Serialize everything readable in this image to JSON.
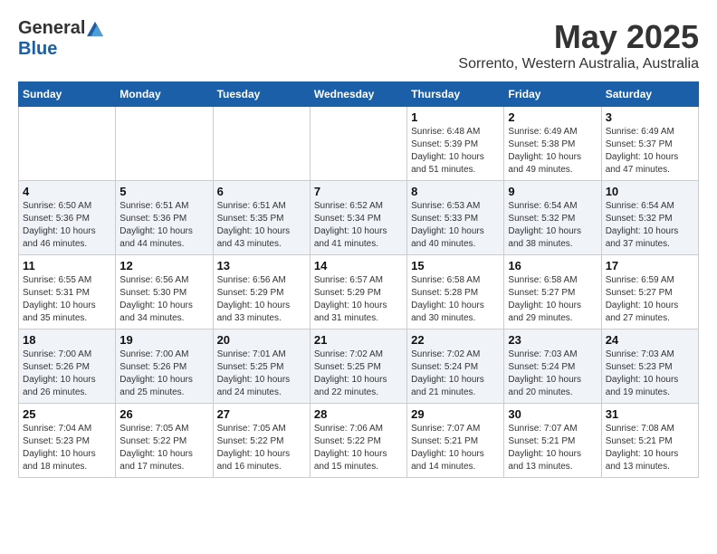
{
  "header": {
    "logo_general": "General",
    "logo_blue": "Blue",
    "month_title": "May 2025",
    "location": "Sorrento, Western Australia, Australia"
  },
  "weekdays": [
    "Sunday",
    "Monday",
    "Tuesday",
    "Wednesday",
    "Thursday",
    "Friday",
    "Saturday"
  ],
  "weeks": [
    [
      {
        "day": "",
        "sunrise": "",
        "sunset": "",
        "daylight": ""
      },
      {
        "day": "",
        "sunrise": "",
        "sunset": "",
        "daylight": ""
      },
      {
        "day": "",
        "sunrise": "",
        "sunset": "",
        "daylight": ""
      },
      {
        "day": "",
        "sunrise": "",
        "sunset": "",
        "daylight": ""
      },
      {
        "day": "1",
        "sunrise": "Sunrise: 6:48 AM",
        "sunset": "Sunset: 5:39 PM",
        "daylight": "Daylight: 10 hours and 51 minutes."
      },
      {
        "day": "2",
        "sunrise": "Sunrise: 6:49 AM",
        "sunset": "Sunset: 5:38 PM",
        "daylight": "Daylight: 10 hours and 49 minutes."
      },
      {
        "day": "3",
        "sunrise": "Sunrise: 6:49 AM",
        "sunset": "Sunset: 5:37 PM",
        "daylight": "Daylight: 10 hours and 47 minutes."
      }
    ],
    [
      {
        "day": "4",
        "sunrise": "Sunrise: 6:50 AM",
        "sunset": "Sunset: 5:36 PM",
        "daylight": "Daylight: 10 hours and 46 minutes."
      },
      {
        "day": "5",
        "sunrise": "Sunrise: 6:51 AM",
        "sunset": "Sunset: 5:36 PM",
        "daylight": "Daylight: 10 hours and 44 minutes."
      },
      {
        "day": "6",
        "sunrise": "Sunrise: 6:51 AM",
        "sunset": "Sunset: 5:35 PM",
        "daylight": "Daylight: 10 hours and 43 minutes."
      },
      {
        "day": "7",
        "sunrise": "Sunrise: 6:52 AM",
        "sunset": "Sunset: 5:34 PM",
        "daylight": "Daylight: 10 hours and 41 minutes."
      },
      {
        "day": "8",
        "sunrise": "Sunrise: 6:53 AM",
        "sunset": "Sunset: 5:33 PM",
        "daylight": "Daylight: 10 hours and 40 minutes."
      },
      {
        "day": "9",
        "sunrise": "Sunrise: 6:54 AM",
        "sunset": "Sunset: 5:32 PM",
        "daylight": "Daylight: 10 hours and 38 minutes."
      },
      {
        "day": "10",
        "sunrise": "Sunrise: 6:54 AM",
        "sunset": "Sunset: 5:32 PM",
        "daylight": "Daylight: 10 hours and 37 minutes."
      }
    ],
    [
      {
        "day": "11",
        "sunrise": "Sunrise: 6:55 AM",
        "sunset": "Sunset: 5:31 PM",
        "daylight": "Daylight: 10 hours and 35 minutes."
      },
      {
        "day": "12",
        "sunrise": "Sunrise: 6:56 AM",
        "sunset": "Sunset: 5:30 PM",
        "daylight": "Daylight: 10 hours and 34 minutes."
      },
      {
        "day": "13",
        "sunrise": "Sunrise: 6:56 AM",
        "sunset": "Sunset: 5:29 PM",
        "daylight": "Daylight: 10 hours and 33 minutes."
      },
      {
        "day": "14",
        "sunrise": "Sunrise: 6:57 AM",
        "sunset": "Sunset: 5:29 PM",
        "daylight": "Daylight: 10 hours and 31 minutes."
      },
      {
        "day": "15",
        "sunrise": "Sunrise: 6:58 AM",
        "sunset": "Sunset: 5:28 PM",
        "daylight": "Daylight: 10 hours and 30 minutes."
      },
      {
        "day": "16",
        "sunrise": "Sunrise: 6:58 AM",
        "sunset": "Sunset: 5:27 PM",
        "daylight": "Daylight: 10 hours and 29 minutes."
      },
      {
        "day": "17",
        "sunrise": "Sunrise: 6:59 AM",
        "sunset": "Sunset: 5:27 PM",
        "daylight": "Daylight: 10 hours and 27 minutes."
      }
    ],
    [
      {
        "day": "18",
        "sunrise": "Sunrise: 7:00 AM",
        "sunset": "Sunset: 5:26 PM",
        "daylight": "Daylight: 10 hours and 26 minutes."
      },
      {
        "day": "19",
        "sunrise": "Sunrise: 7:00 AM",
        "sunset": "Sunset: 5:26 PM",
        "daylight": "Daylight: 10 hours and 25 minutes."
      },
      {
        "day": "20",
        "sunrise": "Sunrise: 7:01 AM",
        "sunset": "Sunset: 5:25 PM",
        "daylight": "Daylight: 10 hours and 24 minutes."
      },
      {
        "day": "21",
        "sunrise": "Sunrise: 7:02 AM",
        "sunset": "Sunset: 5:25 PM",
        "daylight": "Daylight: 10 hours and 22 minutes."
      },
      {
        "day": "22",
        "sunrise": "Sunrise: 7:02 AM",
        "sunset": "Sunset: 5:24 PM",
        "daylight": "Daylight: 10 hours and 21 minutes."
      },
      {
        "day": "23",
        "sunrise": "Sunrise: 7:03 AM",
        "sunset": "Sunset: 5:24 PM",
        "daylight": "Daylight: 10 hours and 20 minutes."
      },
      {
        "day": "24",
        "sunrise": "Sunrise: 7:03 AM",
        "sunset": "Sunset: 5:23 PM",
        "daylight": "Daylight: 10 hours and 19 minutes."
      }
    ],
    [
      {
        "day": "25",
        "sunrise": "Sunrise: 7:04 AM",
        "sunset": "Sunset: 5:23 PM",
        "daylight": "Daylight: 10 hours and 18 minutes."
      },
      {
        "day": "26",
        "sunrise": "Sunrise: 7:05 AM",
        "sunset": "Sunset: 5:22 PM",
        "daylight": "Daylight: 10 hours and 17 minutes."
      },
      {
        "day": "27",
        "sunrise": "Sunrise: 7:05 AM",
        "sunset": "Sunset: 5:22 PM",
        "daylight": "Daylight: 10 hours and 16 minutes."
      },
      {
        "day": "28",
        "sunrise": "Sunrise: 7:06 AM",
        "sunset": "Sunset: 5:22 PM",
        "daylight": "Daylight: 10 hours and 15 minutes."
      },
      {
        "day": "29",
        "sunrise": "Sunrise: 7:07 AM",
        "sunset": "Sunset: 5:21 PM",
        "daylight": "Daylight: 10 hours and 14 minutes."
      },
      {
        "day": "30",
        "sunrise": "Sunrise: 7:07 AM",
        "sunset": "Sunset: 5:21 PM",
        "daylight": "Daylight: 10 hours and 13 minutes."
      },
      {
        "day": "31",
        "sunrise": "Sunrise: 7:08 AM",
        "sunset": "Sunset: 5:21 PM",
        "daylight": "Daylight: 10 hours and 13 minutes."
      }
    ]
  ]
}
